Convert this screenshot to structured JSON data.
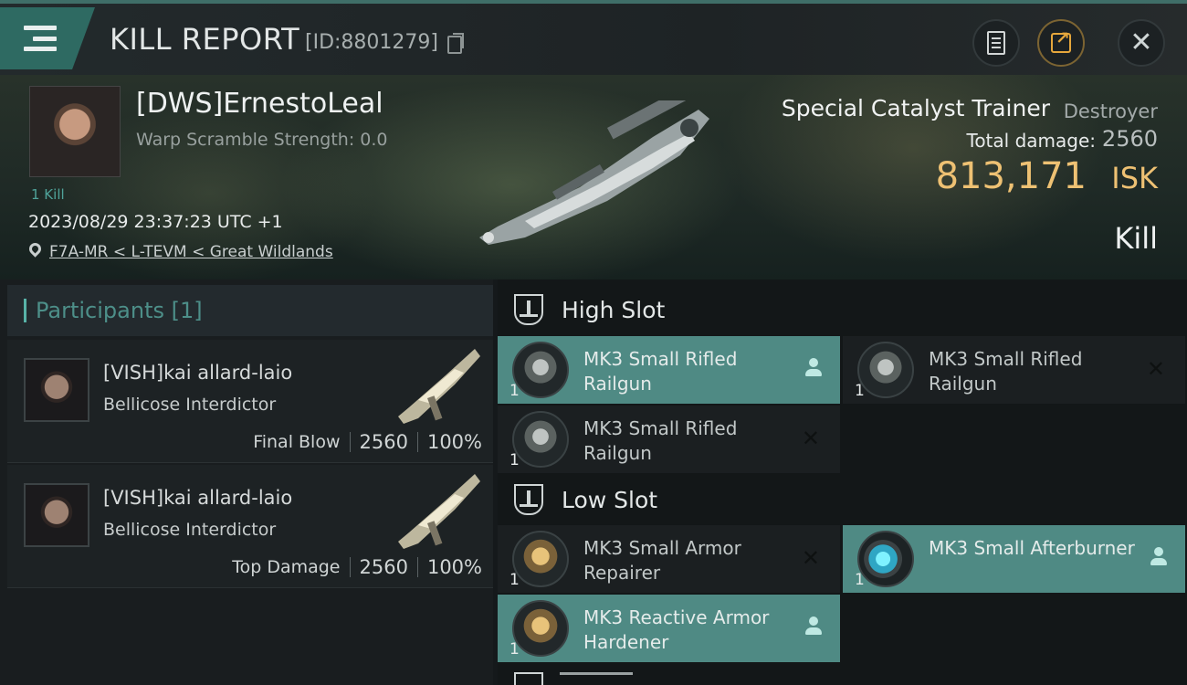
{
  "header": {
    "title": "KILL REPORT",
    "report_id": "[ID:8801279]"
  },
  "victim": {
    "pilot_name": "[DWS]ErnestoLeal",
    "warp_scramble": "Warp Scramble Strength: 0.0",
    "kill_count": "1 Kill",
    "timestamp": "2023/08/29 23:37:23 UTC +1",
    "location": "F7A-MR < L-TEVM < Great Wildlands",
    "ship_name": "Special Catalyst Trainer",
    "ship_class": "Destroyer",
    "total_damage_label": "Total damage:",
    "total_damage_value": "2560",
    "isk_value": "813,171",
    "isk_unit": "ISK",
    "result": "Kill"
  },
  "participants": {
    "header": "Participants [1]",
    "rows": [
      {
        "name": "[VISH]kai allard-laio",
        "ship": "Bellicose Interdictor",
        "role": "Final Blow",
        "damage": "2560",
        "percent": "100%"
      },
      {
        "name": "[VISH]kai allard-laio",
        "ship": "Bellicose Interdictor",
        "role": "Top Damage",
        "damage": "2560",
        "percent": "100%"
      }
    ]
  },
  "fitting": {
    "high_slot_label": "High Slot",
    "low_slot_label": "Low Slot",
    "high": [
      {
        "name": "MK3 Small Rifled Railgun",
        "qty": "1",
        "state": "fitted"
      },
      {
        "name": "MK3 Small Rifled Railgun",
        "qty": "1",
        "state": "destroyed"
      },
      {
        "name": "MK3 Small Rifled Railgun",
        "qty": "1",
        "state": "destroyed"
      }
    ],
    "low": [
      {
        "name": "MK3 Small Armor Repairer",
        "qty": "1",
        "state": "destroyed"
      },
      {
        "name": "MK3 Small Afterburner",
        "qty": "1",
        "state": "fitted"
      },
      {
        "name": "MK3 Reactive Armor Hardener",
        "qty": "1",
        "state": "fitted"
      }
    ]
  },
  "icons": {
    "menu": "hamburger-icon",
    "copy": "copy-icon",
    "doc": "document-icon",
    "share": "share-icon",
    "close": "close-icon",
    "location": "map-pin-icon",
    "slot": "slot-icon",
    "owner": "person-icon",
    "destroyed": "cross-icon"
  },
  "colors": {
    "accent": "#4f8a84",
    "isk": "#eec173",
    "kill_count": "#4fa39a"
  }
}
